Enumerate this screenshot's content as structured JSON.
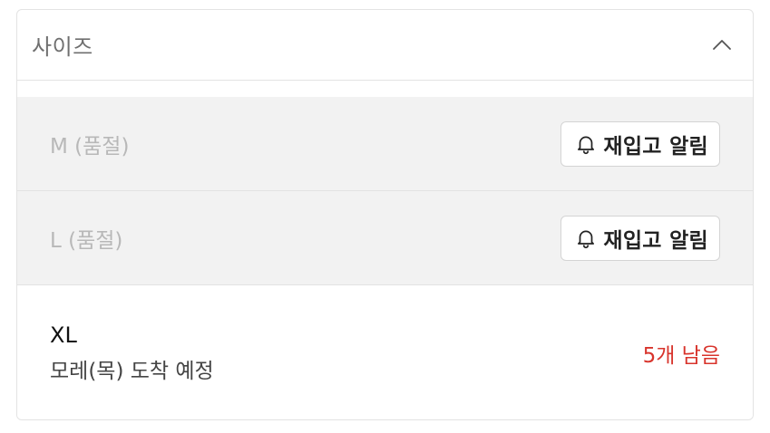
{
  "dropdown": {
    "label": "사이즈",
    "expanded_icon": "chevron-up-icon"
  },
  "options": [
    {
      "name": "M (품절)",
      "status": "soldout",
      "button_label": "재입고 알림",
      "button_icon": "bell-icon"
    },
    {
      "name": "L (품절)",
      "status": "soldout",
      "button_label": "재입고 알림",
      "button_icon": "bell-icon"
    },
    {
      "name": "XL",
      "status": "available",
      "arrival": "모레(목) 도착 예정",
      "stock": "5개 남음"
    }
  ],
  "colors": {
    "stock_red": "#d8342c",
    "soldout_bg": "#f2f2f2",
    "border": "#e3e3e3"
  }
}
